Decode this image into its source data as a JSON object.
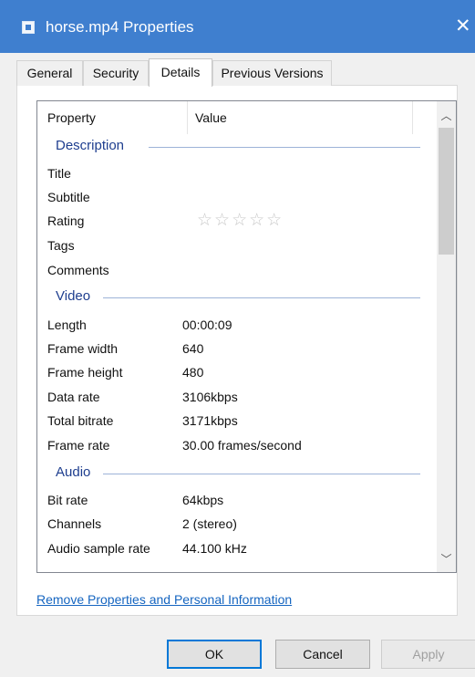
{
  "window": {
    "title": "horse.mp4 Properties",
    "close_label": "✕"
  },
  "tabs": [
    {
      "label": "General"
    },
    {
      "label": "Security"
    },
    {
      "label": "Details"
    },
    {
      "label": "Previous Versions"
    }
  ],
  "table": {
    "headers": {
      "property": "Property",
      "value": "Value"
    },
    "groups": {
      "description": {
        "title": "Description",
        "rows": [
          {
            "label": "Title",
            "value": ""
          },
          {
            "label": "Subtitle",
            "value": ""
          },
          {
            "label": "Rating",
            "value": "☆☆☆☆☆"
          },
          {
            "label": "Tags",
            "value": ""
          },
          {
            "label": "Comments",
            "value": ""
          }
        ]
      },
      "video": {
        "title": "Video",
        "rows": [
          {
            "label": "Length",
            "value": "00:00:09"
          },
          {
            "label": "Frame width",
            "value": "640"
          },
          {
            "label": "Frame height",
            "value": "480"
          },
          {
            "label": "Data rate",
            "value": "3106kbps"
          },
          {
            "label": "Total bitrate",
            "value": "3171kbps"
          },
          {
            "label": "Frame rate",
            "value": "30.00 frames/second"
          }
        ]
      },
      "audio": {
        "title": "Audio",
        "rows": [
          {
            "label": "Bit rate",
            "value": "64kbps"
          },
          {
            "label": "Channels",
            "value": "2 (stereo)"
          },
          {
            "label": "Audio sample rate",
            "value": "44.100 kHz"
          }
        ]
      }
    }
  },
  "link_text": "Remove Properties and Personal Information",
  "buttons": {
    "ok": "OK",
    "cancel": "Cancel",
    "apply": "Apply"
  },
  "colors": {
    "titlebar": "#3f7fcf",
    "group_title": "#1e3e8f",
    "link": "#1565c0",
    "default_button_border": "#0078d7"
  }
}
